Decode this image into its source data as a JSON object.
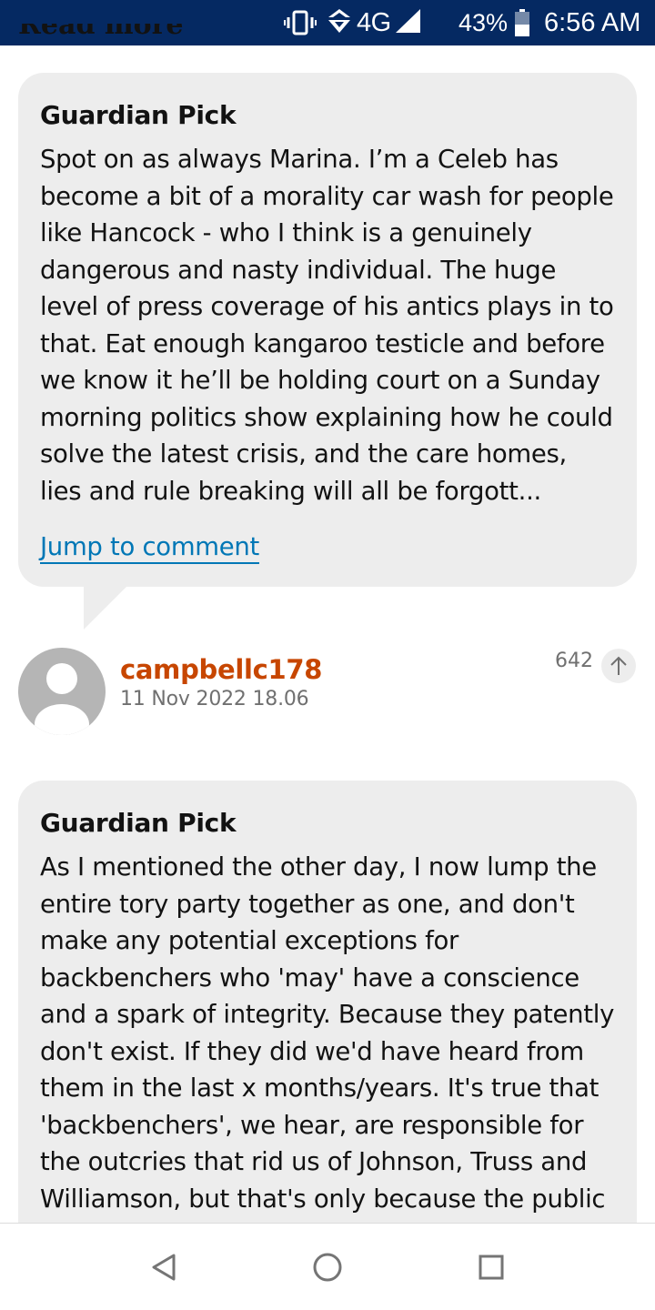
{
  "status_bar": {
    "network": "4G",
    "battery": "43%",
    "time": "6:56 AM",
    "icons": [
      "vibrate-icon",
      "data-transfer-icon",
      "signal-icon",
      "battery-icon"
    ]
  },
  "peek_heading": "Read more",
  "picks": [
    {
      "label": "Guardian Pick",
      "body": "Spot on as always Marina. I’m a Celeb has become a bit of a morality car wash for people like Hancock - who I think is a genuinely dangerous and nasty individual. The huge level of press coverage of his antics plays in to that. Eat enough kangaroo testicle and before we know it he’ll be holding court on a Sunday morning politics show explaining how he could solve the latest crisis, and the care homes, lies and rule breaking will all be forgott...",
      "jump_label": "Jump to comment"
    },
    {
      "label": "Guardian Pick",
      "body": "As I mentioned the other day, I now lump the entire tory party together as one, and don't make any potential exceptions for backbenchers who 'may' have a conscience and a spark of integrity. Because they patently don't exist. If they did we'd have heard from them in the last x months/years. It's true that 'backbenchers', we hear, are responsible for the outcries that rid us of Johnson, Truss and Williamson, but that's only because the public"
    }
  ],
  "comment": {
    "username": "campbellc178",
    "timestamp": "11 Nov 2022 18.06",
    "recommend_count": "642"
  },
  "colors": {
    "status_bar_bg": "#052962",
    "card_bg": "#ededed",
    "username": "#c74600",
    "link": "#0077b6"
  }
}
